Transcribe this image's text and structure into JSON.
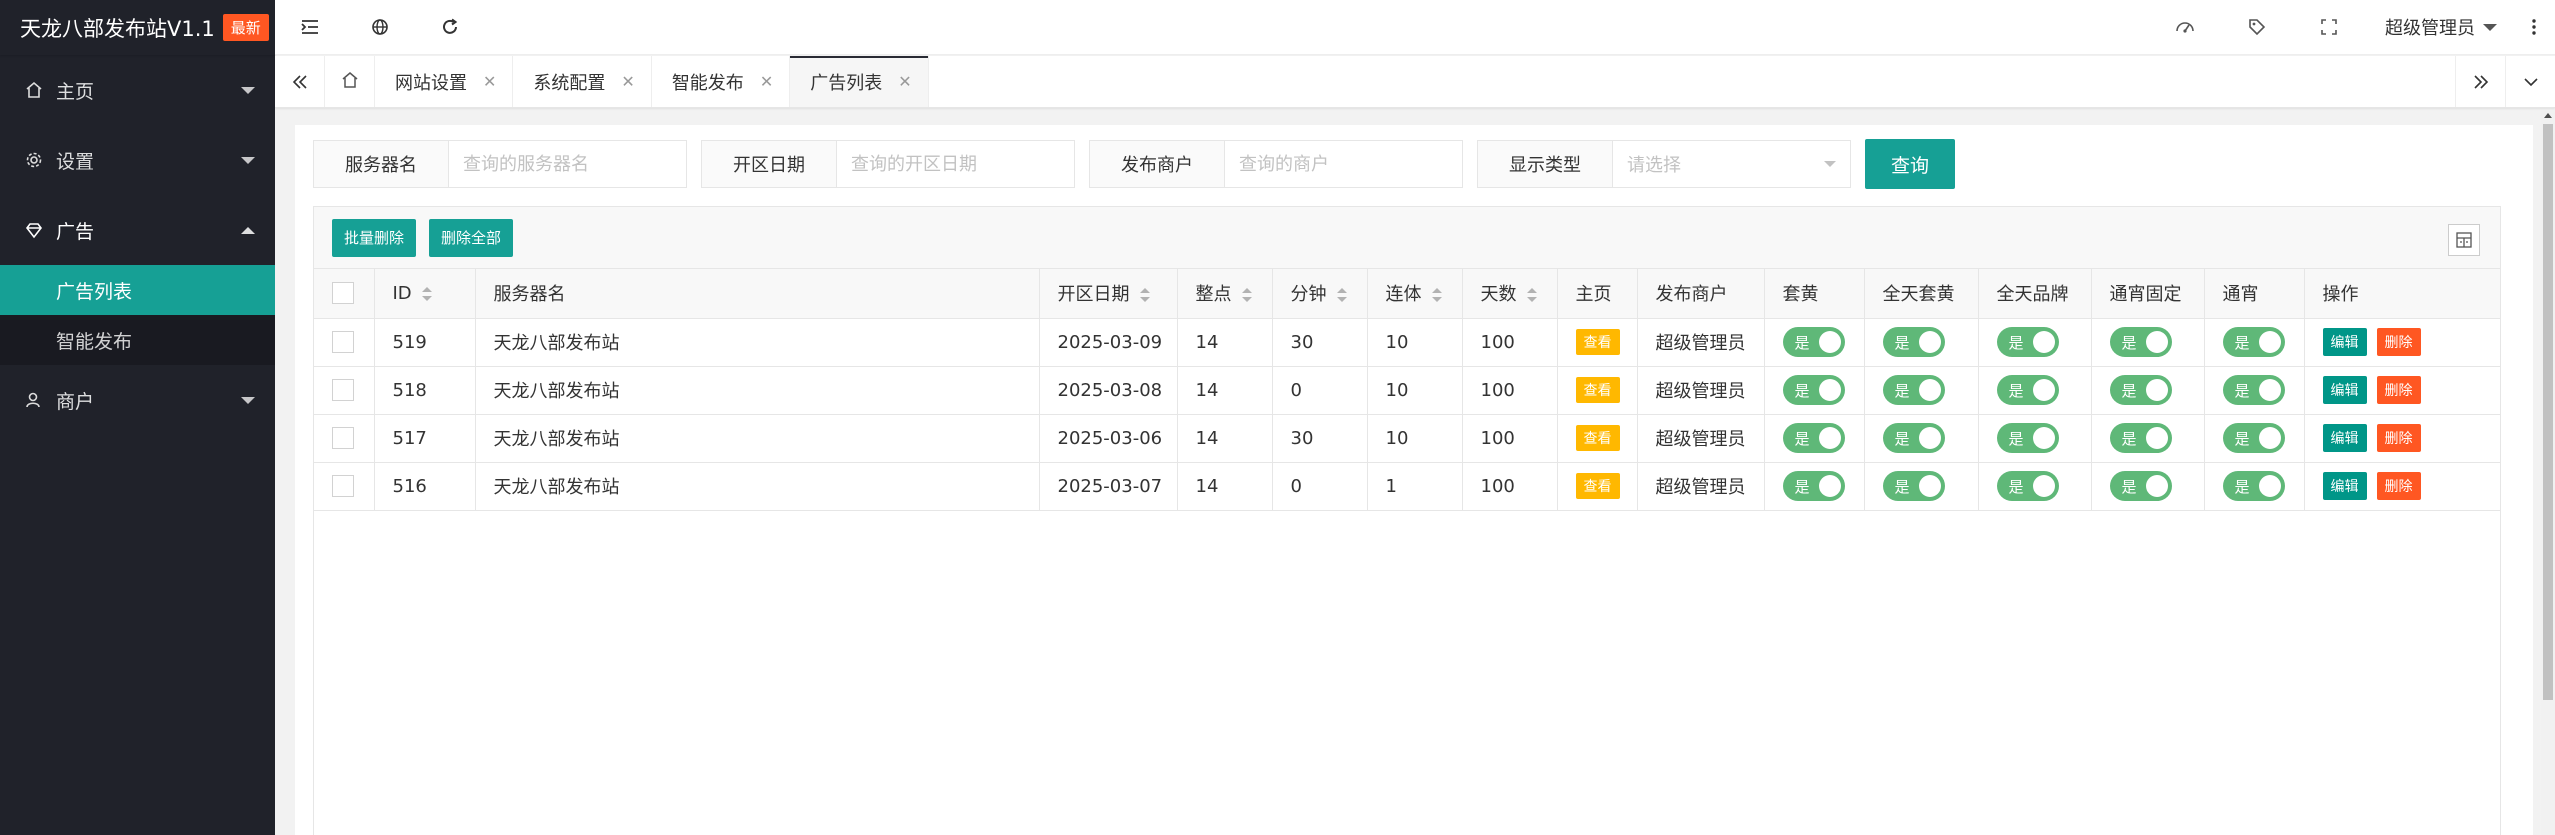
{
  "app": {
    "title": "天龙八部发布站V1.1",
    "badge": "最新"
  },
  "sidebar": {
    "items": [
      {
        "label": "主页",
        "icon": "home-icon"
      },
      {
        "label": "设置",
        "icon": "gear-icon"
      },
      {
        "label": "广告",
        "icon": "diamond-icon",
        "expanded": true,
        "children": [
          {
            "label": "广告列表",
            "active": true
          },
          {
            "label": "智能发布"
          }
        ]
      },
      {
        "label": "商户",
        "icon": "user-icon"
      }
    ]
  },
  "header": {
    "icons": [
      "menu-collapse-icon",
      "globe-icon",
      "refresh-icon"
    ],
    "right_icons": [
      "theme-icon",
      "tag-icon",
      "fullscreen-icon"
    ],
    "user": "超级管理员"
  },
  "tabs": [
    {
      "label": "网站设置"
    },
    {
      "label": "系统配置"
    },
    {
      "label": "智能发布"
    },
    {
      "label": "广告列表",
      "active": true
    }
  ],
  "search": {
    "server_label": "服务器名",
    "server_placeholder": "查询的服务器名",
    "date_label": "开区日期",
    "date_placeholder": "查询的开区日期",
    "merchant_label": "发布商户",
    "merchant_placeholder": "查询的商户",
    "type_label": "显示类型",
    "type_placeholder": "请选择",
    "query_button": "查询"
  },
  "toolbar": {
    "batch_delete": "批量删除",
    "delete_all": "删除全部"
  },
  "table": {
    "columns": [
      "ID",
      "服务器名",
      "开区日期",
      "整点",
      "分钟",
      "连体",
      "天数",
      "主页",
      "发布商户",
      "套黄",
      "全天套黄",
      "全天品牌",
      "通宵固定",
      "通宵",
      "操作"
    ],
    "view_label": "查看",
    "switch_label": "是",
    "edit_label": "编辑",
    "delete_label": "删除",
    "rows": [
      {
        "id": "519",
        "server": "天龙八部发布站",
        "date": "2025-03-09",
        "hour": "14",
        "minute": "30",
        "linked": "10",
        "days": "100",
        "merchant": "超级管理员"
      },
      {
        "id": "518",
        "server": "天龙八部发布站",
        "date": "2025-03-08",
        "hour": "14",
        "minute": "0",
        "linked": "10",
        "days": "100",
        "merchant": "超级管理员"
      },
      {
        "id": "517",
        "server": "天龙八部发布站",
        "date": "2025-03-06",
        "hour": "14",
        "minute": "30",
        "linked": "10",
        "days": "100",
        "merchant": "超级管理员"
      },
      {
        "id": "516",
        "server": "天龙八部发布站",
        "date": "2025-03-07",
        "hour": "14",
        "minute": "0",
        "linked": "1",
        "days": "100",
        "merchant": "超级管理员"
      }
    ]
  },
  "colors": {
    "accent": "#16a095",
    "sidebar": "#20222a",
    "warn": "#ff5722",
    "view": "#ffb800",
    "switch_on": "#5fb878"
  }
}
